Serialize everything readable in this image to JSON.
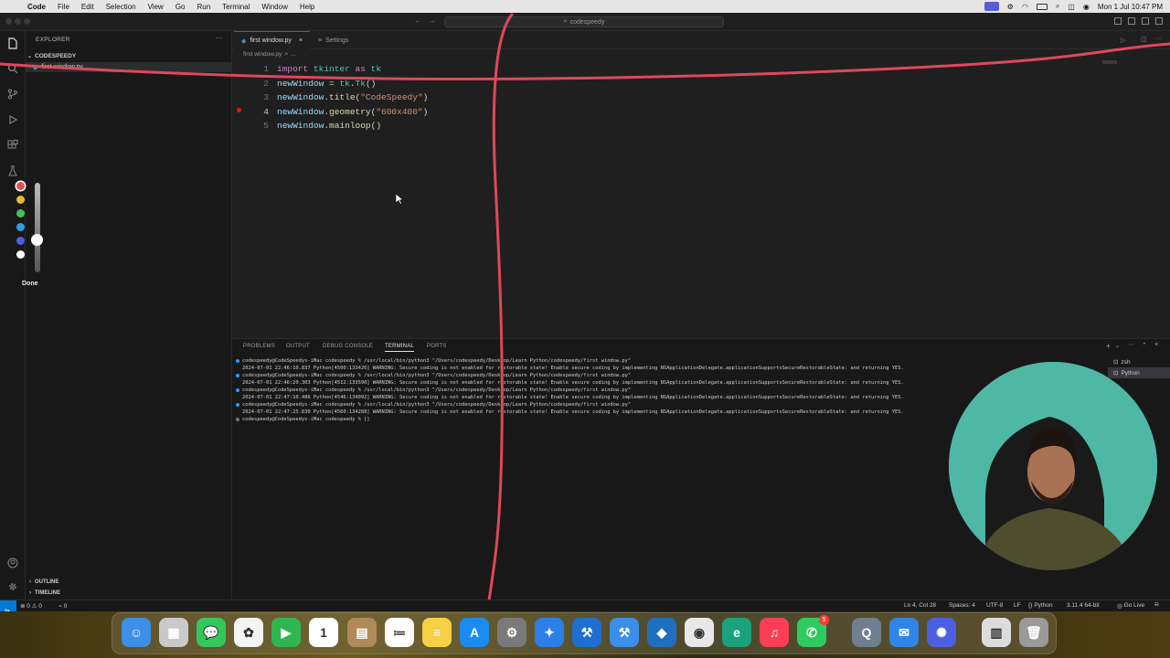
{
  "menubar": {
    "app_name": "Code",
    "items": [
      "File",
      "Edit",
      "Selection",
      "View",
      "Go",
      "Run",
      "Terminal",
      "Window",
      "Help"
    ],
    "datetime": "Mon 1 Jul  10:47 PM"
  },
  "titlebar": {
    "search_text": "codespeedy"
  },
  "sidebar": {
    "title": "EXPLORER",
    "folder": "CODESPEEDY",
    "file": "first window.py",
    "outline_label": "OUTLINE",
    "timeline_label": "TIMELINE"
  },
  "tabs": [
    {
      "label": "first window.py",
      "active": true
    },
    {
      "label": "Settings",
      "active": false
    }
  ],
  "breadcrumb": [
    "first window.py",
    ">",
    "..."
  ],
  "editor": {
    "line_numbers": [
      "1",
      "2",
      "3",
      "4",
      "5"
    ],
    "lines": [
      [
        {
          "t": "import",
          "c": "kw"
        },
        {
          "t": " tkinter ",
          "c": "mod"
        },
        {
          "t": "as",
          "c": "kw"
        },
        {
          "t": " tk",
          "c": "mod"
        }
      ],
      [
        {
          "t": "newWindow",
          "c": "var"
        },
        {
          "t": " = ",
          "c": "pl"
        },
        {
          "t": "tk",
          "c": "mod"
        },
        {
          "t": ".",
          "c": "pl"
        },
        {
          "t": "Tk",
          "c": "mod"
        },
        {
          "t": "()",
          "c": "pl"
        }
      ],
      [
        {
          "t": "newWindow",
          "c": "var"
        },
        {
          "t": ".",
          "c": "pl"
        },
        {
          "t": "title",
          "c": "fn"
        },
        {
          "t": "(",
          "c": "pl"
        },
        {
          "t": "\"CodeSpeedy\"",
          "c": "str"
        },
        {
          "t": ")",
          "c": "pl"
        }
      ],
      [
        {
          "t": "newWindow",
          "c": "var"
        },
        {
          "t": ".",
          "c": "pl"
        },
        {
          "t": "geometry",
          "c": "fn"
        },
        {
          "t": "(",
          "c": "pl"
        },
        {
          "t": "\"600x400\"",
          "c": "str"
        },
        {
          "t": ")",
          "c": "pl"
        }
      ],
      [
        {
          "t": "newWindow",
          "c": "var"
        },
        {
          "t": ".",
          "c": "pl"
        },
        {
          "t": "mainloop",
          "c": "fn"
        },
        {
          "t": "()",
          "c": "pl"
        }
      ]
    ]
  },
  "pen_tool": {
    "colors": [
      "#e05252",
      "#e8b83a",
      "#3ec25a",
      "#2f9be8",
      "#4b5fe0",
      "#ffffff"
    ],
    "done_label": "Done"
  },
  "panel": {
    "tabs": [
      "PROBLEMS",
      "OUTPUT",
      "DEBUG CONSOLE",
      "TERMINAL",
      "PORTS"
    ],
    "active_tab": "TERMINAL",
    "terminal_lines": [
      {
        "dot": "blue",
        "text": "codespeedy@CodeSpeedys-iMac codespeedy % /usr/local/bin/python3 \"/Users/codespeedy/Desktop/Learn Python/codespeedy/first window.py\""
      },
      {
        "dot": "",
        "text": "2024-07-01 22:46:10.837 Python[4500:133426] WARNING: Secure coding is not enabled for restorable state! Enable secure coding by implementing NSApplicationDelegate.applicationSupportsSecureRestorableState: and returning YES."
      },
      {
        "dot": "blue",
        "text": "codespeedy@CodeSpeedys-iMac codespeedy % /usr/local/bin/python3 \"/Users/codespeedy/Desktop/Learn Python/codespeedy/first window.py\""
      },
      {
        "dot": "",
        "text": "2024-07-01 22:46:20.303 Python[4512:133590] WARNING: Secure coding is not enabled for restorable state! Enable secure coding by implementing NSApplicationDelegate.applicationSupportsSecureRestorableState: and returning YES."
      },
      {
        "dot": "blue",
        "text": "codespeedy@CodeSpeedys-iMac codespeedy % /usr/local/bin/python3 \"/Users/codespeedy/Desktop/Learn Python/codespeedy/first window.py\""
      },
      {
        "dot": "",
        "text": "2024-07-01 22:47:10.486 Python[4546:134092] WARNING: Secure coding is not enabled for restorable state! Enable secure coding by implementing NSApplicationDelegate.applicationSupportsSecureRestorableState: and returning YES."
      },
      {
        "dot": "blue",
        "text": "codespeedy@CodeSpeedys-iMac codespeedy % /usr/local/bin/python3 \"/Users/codespeedy/Desktop/Learn Python/codespeedy/first window.py\""
      },
      {
        "dot": "",
        "text": "2024-07-01 22:47:25.830 Python[4560:134288] WARNING: Secure coding is not enabled for restorable state! Enable secure coding by implementing NSApplicationDelegate.applicationSupportsSecureRestorableState: and returning YES."
      },
      {
        "dot": "gray",
        "text": "codespeedy@CodeSpeedys-iMac codespeedy % []"
      }
    ],
    "terminal_list": [
      "zsh",
      "Python"
    ]
  },
  "statusbar": {
    "problems": "⊗ 0 ⚠ 0",
    "ports": "⌁ 0",
    "ln_col": "Ln 4, Col 28",
    "spaces": "Spaces: 4",
    "encoding": "UTF-8",
    "eol": "LF",
    "language": "Python",
    "interpreter": "3.11.4 64-bit",
    "go_live": "Go Live"
  },
  "dock_apps": [
    {
      "name": "finder",
      "bg": "#3d8fe8",
      "glyph": "☺"
    },
    {
      "name": "launchpad",
      "bg": "#c9c9c9",
      "glyph": "▦"
    },
    {
      "name": "messages",
      "bg": "#34c759",
      "glyph": "💬"
    },
    {
      "name": "photos",
      "bg": "#f4f4f4",
      "glyph": "✿"
    },
    {
      "name": "facetime",
      "bg": "#2fb650",
      "glyph": "▶"
    },
    {
      "name": "calendar",
      "bg": "#ffffff",
      "glyph": "1"
    },
    {
      "name": "contacts",
      "bg": "#b08a5a",
      "glyph": "▤"
    },
    {
      "name": "reminders",
      "bg": "#ffffff",
      "glyph": "≔"
    },
    {
      "name": "notes",
      "bg": "#f7d046",
      "glyph": "≡"
    },
    {
      "name": "app-store",
      "bg": "#1a8cf0",
      "glyph": "A"
    },
    {
      "name": "system-settings",
      "bg": "#7a7a7a",
      "glyph": "⚙"
    },
    {
      "name": "safari",
      "bg": "#2b7fe6",
      "glyph": "✦"
    },
    {
      "name": "xcode",
      "bg": "#1e6fd1",
      "glyph": "⚒"
    },
    {
      "name": "xcode-alt",
      "bg": "#3a8fe8",
      "glyph": "⚒"
    },
    {
      "name": "vscode",
      "bg": "#1f6fc0",
      "glyph": "◆"
    },
    {
      "name": "chrome",
      "bg": "#e8e8e8",
      "glyph": "◉"
    },
    {
      "name": "edge",
      "bg": "#1aa27c",
      "glyph": "e"
    },
    {
      "name": "music",
      "bg": "#fa3e55",
      "glyph": "♫"
    },
    {
      "name": "whatsapp",
      "bg": "#2ecb61",
      "glyph": "✆"
    },
    {
      "name": "quicktime",
      "bg": "#6f7f8f",
      "glyph": "Q"
    },
    {
      "name": "mail",
      "bg": "#2f86e8",
      "glyph": "✉"
    },
    {
      "name": "app-extra",
      "bg": "#4b5fe0",
      "glyph": "✺"
    },
    {
      "name": "document",
      "bg": "#dcdcdc",
      "glyph": "▥"
    },
    {
      "name": "trash",
      "bg": "#9a9a9a",
      "glyph": "🗑"
    }
  ],
  "whatsapp_badge": "5",
  "colors": {
    "accent": "#0078d4",
    "annotation": "#e0475b"
  }
}
